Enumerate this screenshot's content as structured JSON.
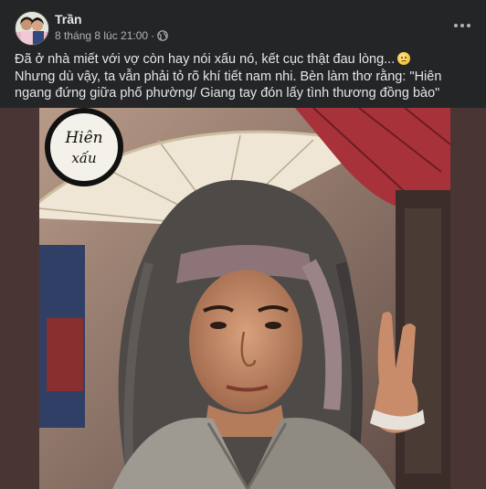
{
  "post": {
    "author": "Trần",
    "timestamp": "8 tháng 8 lúc 21:00",
    "separator": "·",
    "privacy_icon": "globe-icon",
    "more_icon": "more-horizontal-icon",
    "text_line1": "Đã ở nhà miết với vợ còn hay nói xấu nó, kết cục thật đau lòng...",
    "text_line1_emoji": "sad-face-emoji",
    "text_line2": "Nhưng dù vậy, ta vẫn phải tỏ rõ khí tiết nam nhi. Bèn làm thơ rằng: \"Hiên ngang đứng giữa phố phường/ Giang tay đón lấy tình thương đồng bào\"",
    "image": {
      "logo_text_top": "Hiên",
      "logo_text_bottom": "xấu"
    }
  },
  "colors": {
    "background": "#242526",
    "text_primary": "#e4e6eb",
    "text_secondary": "#b0b3b8",
    "media_backdrop": "#4a3535"
  }
}
